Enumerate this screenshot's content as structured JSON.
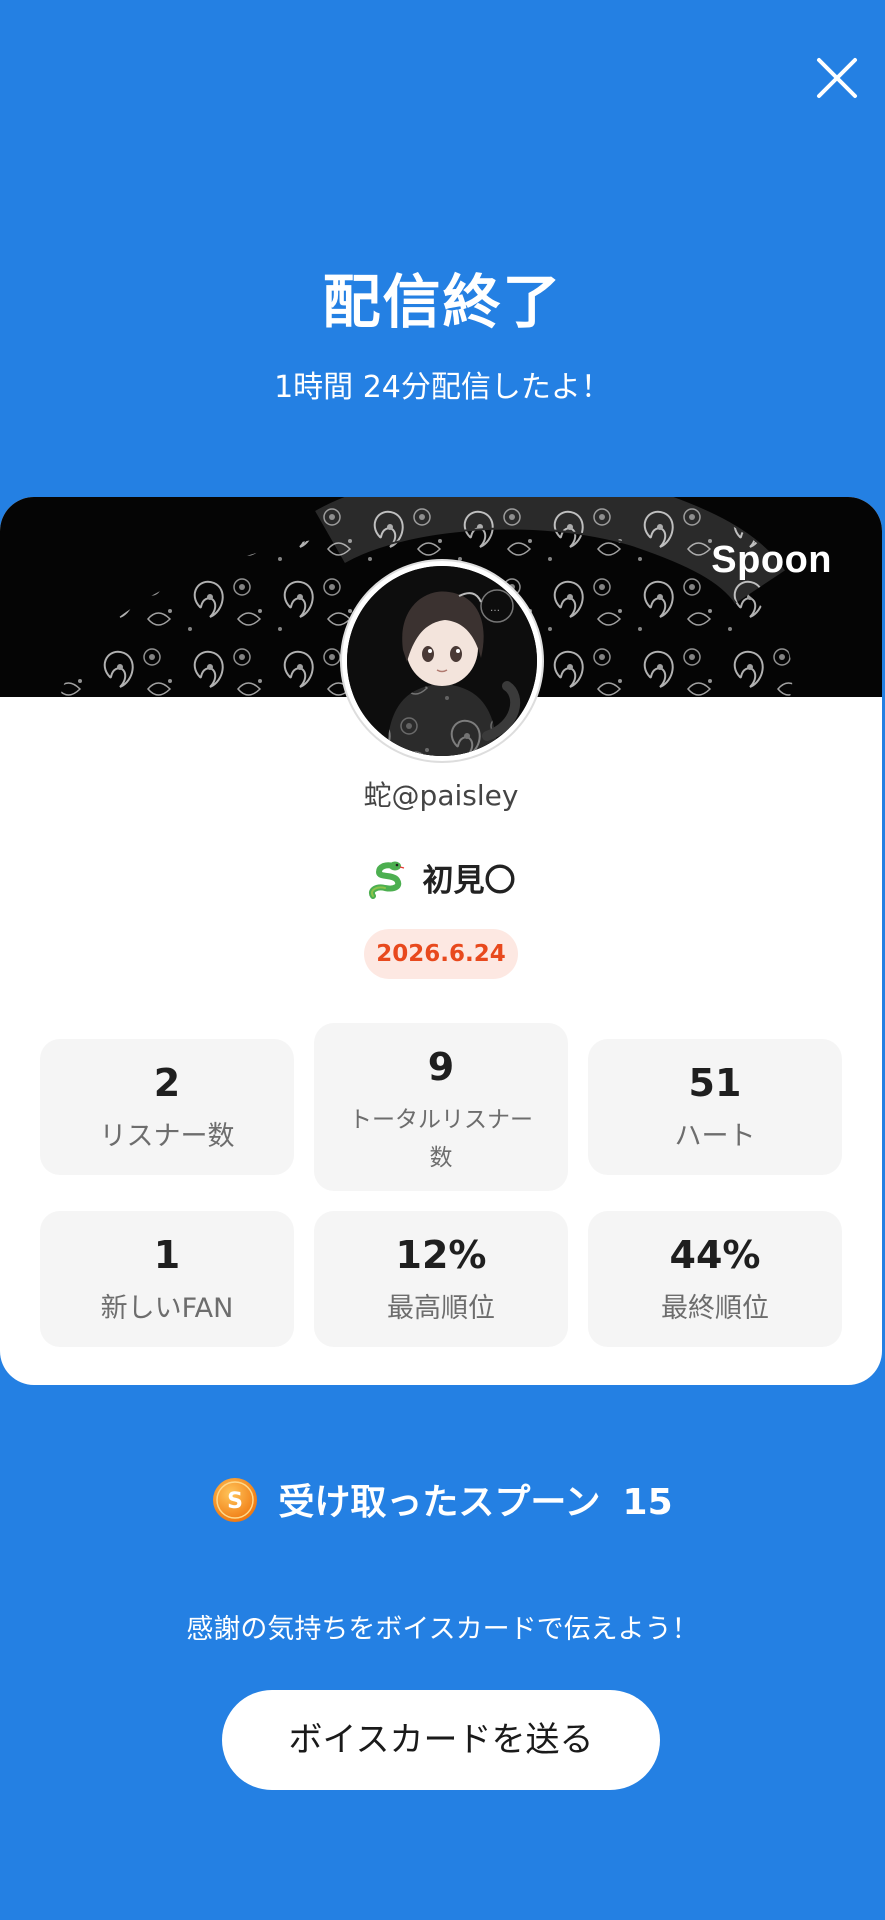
{
  "header": {
    "title": "配信終了",
    "subtitle": "1時間 24分配信したよ！",
    "close_icon": "close-icon"
  },
  "card": {
    "brand": "Spoon",
    "banner_image": "paisley-snake-banner",
    "avatar_image": "user-avatar-illustration",
    "username": "蛇@paisley",
    "live_title": "初見〇",
    "title_icon": "snake-emoji-icon",
    "date": "2026.6.24",
    "date_color": "#E8491D",
    "stats": [
      {
        "value": "2",
        "label": "リスナー数"
      },
      {
        "value": "9",
        "label": "トータルリスナー数"
      },
      {
        "value": "51",
        "label": "ハート"
      },
      {
        "value": "1",
        "label": "新しいFAN"
      },
      {
        "value": "12%",
        "label": "最高順位"
      },
      {
        "value": "44%",
        "label": "最終順位"
      }
    ]
  },
  "spoons": {
    "icon": "spoon-coin-icon",
    "label": "受け取ったスプーン",
    "count": "15"
  },
  "thanks_text": "感謝の気持ちをボイスカードで伝えよう！",
  "voice_card_button": "ボイスカードを送る",
  "colors": {
    "background": "#2480E3",
    "card": "#FFFFFF",
    "stat_bg": "#F5F5F5",
    "badge_bg": "#FDE8E2"
  }
}
